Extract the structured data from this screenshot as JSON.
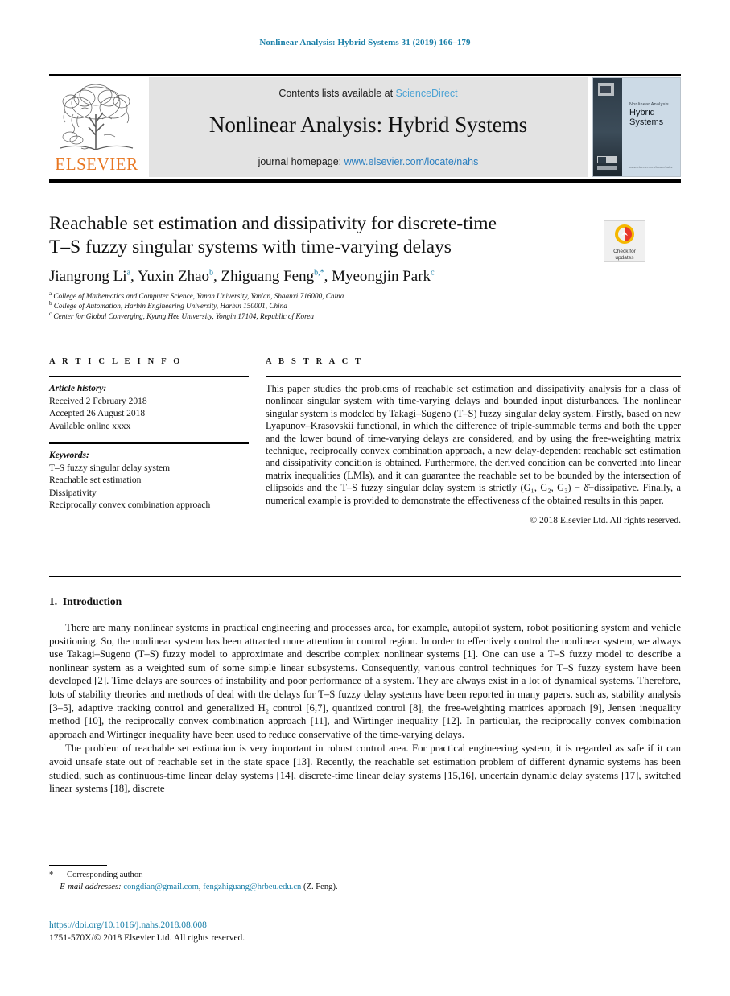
{
  "running_head": "Nonlinear Analysis: Hybrid Systems 31 (2019) 166–179",
  "masthead": {
    "publisher_name": "ELSEVIER",
    "contents_prefix": "Contents lists available at ",
    "contents_link": "ScienceDirect",
    "journal_title": "Nonlinear Analysis: Hybrid Systems",
    "homepage_prefix": "journal homepage: ",
    "homepage_link": "www.elsevier.com/locate/nahs",
    "cover": {
      "superline": "Nonlinear Analysis",
      "title_line1": "Hybrid",
      "title_line2": "Systems",
      "footline": "www.elsevier.com/locate/nahs"
    }
  },
  "article": {
    "title_line1": "Reachable set estimation and dissipativity for discrete-time",
    "title_line2": "T–S fuzzy singular systems with time-varying delays",
    "crossmark": {
      "line1": "Check for",
      "line2": "updates"
    },
    "authors": [
      {
        "name": "Jiangrong Li",
        "sup": "a",
        "sep": ", "
      },
      {
        "name": "Yuxin Zhao",
        "sup": "b",
        "sep": ", "
      },
      {
        "name": "Zhiguang Feng",
        "sup": "b,*",
        "sep": ", "
      },
      {
        "name": "Myeongjin Park",
        "sup": "c",
        "sep": ""
      }
    ],
    "affiliations": [
      {
        "marker": "a",
        "text": "College of Mathematics and Computer Science, Yanan University, Yan'an, Shaanxi 716000, China"
      },
      {
        "marker": "b",
        "text": "College of Automation, Harbin Engineering University, Harbin  150001, China"
      },
      {
        "marker": "c",
        "text": "Center for Global Converging, Kyung Hee University, Yongin  17104, Republic of Korea"
      }
    ]
  },
  "article_info": {
    "heading": "A R T I C L E   I N F O",
    "history_label": "Article history:",
    "history": [
      "Received 2 February 2018",
      "Accepted 26 August 2018",
      "Available online xxxx"
    ],
    "keywords_label": "Keywords:",
    "keywords": [
      "T–S fuzzy singular delay system",
      "Reachable set estimation",
      "Dissipativity",
      "Reciprocally convex combination approach"
    ]
  },
  "abstract": {
    "heading": "A B S T R A C T",
    "text_part1": "This paper studies the problems of reachable set estimation and dissipativity analysis for a class of nonlinear singular system with time-varying delays and bounded input disturbances. The nonlinear singular system is modeled by Takagi–Sugeno (T–S) fuzzy singular delay system. Firstly, based on new Lyapunov–Krasovskii functional, in which the difference of triple-summable terms and both the upper and the lower bound of time-varying delays are considered, and by using the free-weighting matrix technique, reciprocally convex combination approach, a new delay-dependent reachable set estimation and dissipativity condition is obtained. Furthermore, the derived condition can be converted into linear matrix inequalities (LMIs), and it can guarantee the reachable set to be bounded by the intersection of ellipsoids and the T–S fuzzy singular delay system is strictly ",
    "dissipative_formula": "(G₁, G₂, G₃) − δ̄−dissipative.",
    "text_part2": " Finally, a numerical example is provided to demonstrate the effectiveness of the obtained results in this paper.",
    "copyright": "© 2018 Elsevier Ltd. All rights reserved."
  },
  "introduction": {
    "section_number": "1.",
    "section_title": "Introduction",
    "paragraph1": "There are many nonlinear systems in practical engineering and processes area, for example, autopilot system, robot positioning system and vehicle positioning. So, the nonlinear system has been attracted more attention in control region. In order to effectively control the nonlinear system, we always use Takagi–Sugeno (T–S) fuzzy model to approximate and describe complex nonlinear systems [1]. One can use a T–S fuzzy model to describe a nonlinear system as a weighted sum of some simple linear subsystems. Consequently, various control techniques for T–S fuzzy system have been developed [2]. Time delays are sources of instability and poor performance of a system. They are always exist in a lot of dynamical systems. Therefore, lots of stability theories and methods of deal with the delays for T–S fuzzy delay systems have been reported in many papers, such as, stability analysis [3–5], adaptive tracking control and generalized H₂ control [6,7], quantized control [8], the free-weighting matrices approach [9], Jensen inequality method [10], the reciprocally convex combination approach [11], and Wirtinger inequality [12]. In particular, the reciprocally convex combination approach and Wirtinger inequality have been used to reduce conservative of the time-varying delays.",
    "paragraph2": "The problem of reachable set estimation is very important in robust control area. For practical engineering system, it is regarded as safe if it can avoid unsafe state out of reachable set in the state space [13]. Recently, the reachable set estimation problem of different dynamic systems has been studied, such as continuous-time linear delay systems [14], discrete-time linear delay systems [15,16], uncertain dynamic delay systems [17], switched linear systems [18], discrete"
  },
  "footer": {
    "corresponding_marker": "*",
    "corresponding_text": "Corresponding author.",
    "emails_label": "E-mail addresses:",
    "email1": "congdian@gmail.com",
    "email_sep": ", ",
    "email2": "fengzhiguang@hrbeu.edu.cn",
    "email_suffix": " (Z. Feng).",
    "doi": "https://doi.org/10.1016/j.nahs.2018.08.008",
    "rights": "1751-570X/© 2018 Elsevier Ltd. All rights reserved."
  },
  "colors": {
    "link_blue": "#1a7fa8",
    "sciencedirect_blue": "#4da3d4",
    "homepage_blue": "#2a7fc0",
    "elsevier_orange": "#e87722"
  }
}
